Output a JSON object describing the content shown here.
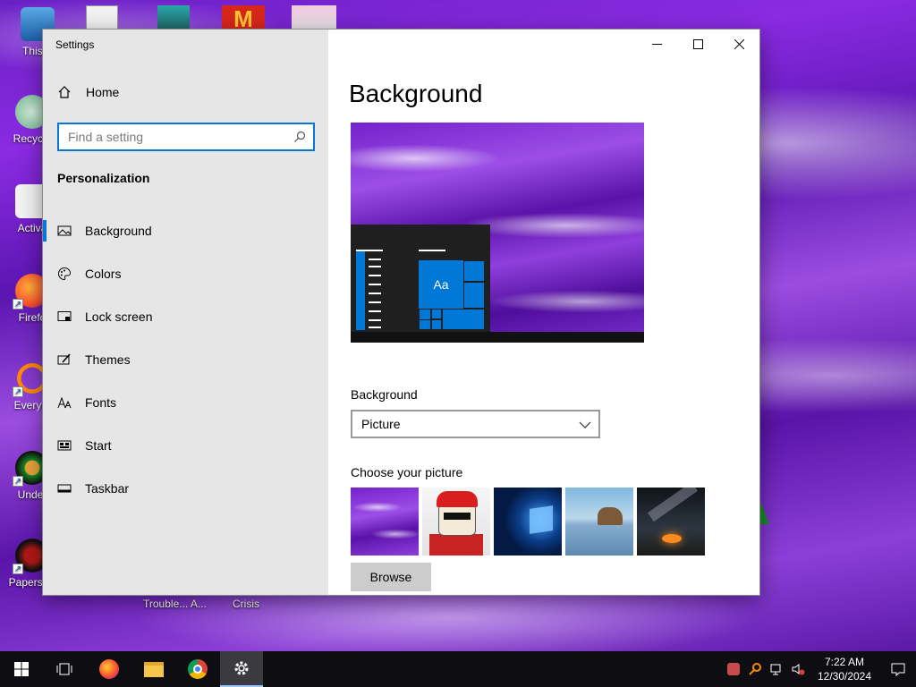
{
  "desktop": {
    "icons": [
      {
        "label": "This P"
      },
      {
        "label": "Recycle"
      },
      {
        "label": "Activa"
      },
      {
        "label": "Firefo"
      },
      {
        "label": "Everyth"
      },
      {
        "label": "Under"
      },
      {
        "label": "Papers, P"
      }
    ],
    "bottom_labels": [
      "Trouble... A...",
      "Crisis"
    ]
  },
  "window": {
    "title": "Settings",
    "controls": {
      "minimize": "minimize",
      "maximize": "maximize",
      "close": "close"
    }
  },
  "sidebar": {
    "home_label": "Home",
    "search_placeholder": "Find a setting",
    "section_title": "Personalization",
    "items": [
      {
        "label": "Background",
        "icon": "picture-icon",
        "active": true
      },
      {
        "label": "Colors",
        "icon": "palette-icon",
        "active": false
      },
      {
        "label": "Lock screen",
        "icon": "lock-screen-icon",
        "active": false
      },
      {
        "label": "Themes",
        "icon": "brush-icon",
        "active": false
      },
      {
        "label": "Fonts",
        "icon": "fonts-icon",
        "active": false
      },
      {
        "label": "Start",
        "icon": "start-icon",
        "active": false
      },
      {
        "label": "Taskbar",
        "icon": "taskbar-icon",
        "active": false
      }
    ]
  },
  "main": {
    "title": "Background",
    "preview_tile_text": "Aa",
    "background_label": "Background",
    "background_value": "Picture",
    "choose_label": "Choose your picture",
    "browse_label": "Browse"
  },
  "taskbar": {
    "time": "7:22 AM",
    "date": "12/30/2024"
  },
  "colors": {
    "accent": "#0078d7",
    "sidebar_bg": "#e6e6e6",
    "taskbar_bg": "#0d0d12"
  }
}
